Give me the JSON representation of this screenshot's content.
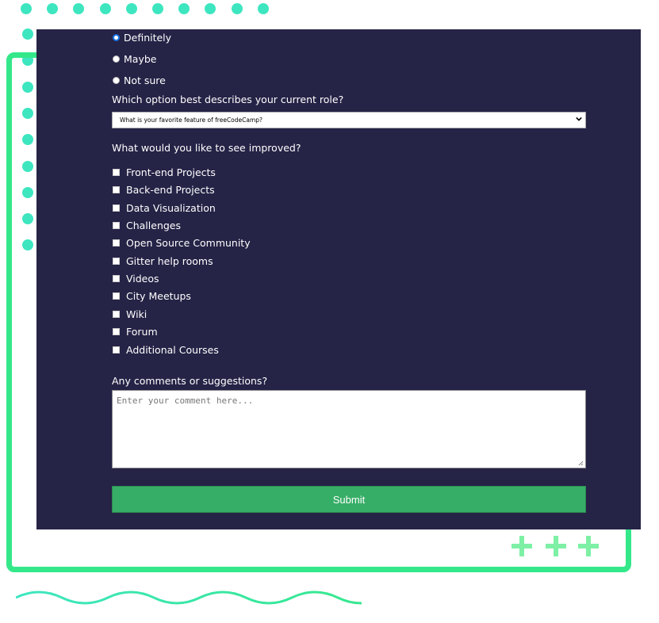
{
  "decoration": {
    "accent_green": "#34e88a",
    "accent_teal": "#3ee6c0",
    "panel_bg": "#252346",
    "submit_bg": "#37ae67"
  },
  "recommend": {
    "options": [
      {
        "label": "Definitely",
        "checked": true
      },
      {
        "label": "Maybe",
        "checked": false
      },
      {
        "label": "Not sure",
        "checked": false
      }
    ]
  },
  "role": {
    "question": "Which option best describes your current role?",
    "selected": "What is your favorite feature of freeCodeCamp?"
  },
  "improve": {
    "question": "What would you like to see improved?",
    "options": [
      "Front-end Projects",
      "Back-end Projects",
      "Data Visualization",
      "Challenges",
      "Open Source Community",
      "Gitter help rooms",
      "Videos",
      "City Meetups",
      "Wiki",
      "Forum",
      "Additional Courses"
    ]
  },
  "comments": {
    "question": "Any comments or suggestions?",
    "placeholder": "Enter your comment here..."
  },
  "submit": {
    "label": "Submit"
  }
}
